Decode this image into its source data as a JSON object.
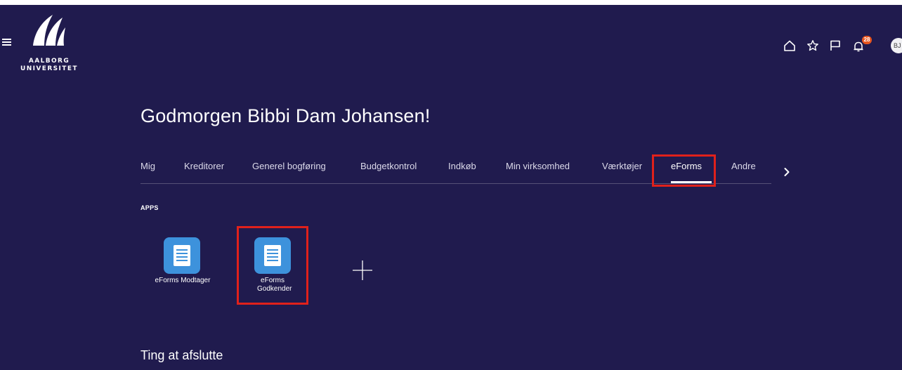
{
  "header": {
    "logo_line1": "AALBORG",
    "logo_line2": "UNIVERSITET",
    "icons": [
      "home-icon",
      "star-icon",
      "flag-icon",
      "bell-icon"
    ],
    "notification_count": "28",
    "avatar_initials": "BJ"
  },
  "greeting": "Godmorgen Bibbi Dam Johansen!",
  "tabs": [
    {
      "label": "Mig"
    },
    {
      "label": "Kreditorer"
    },
    {
      "label": "Generel bogføring"
    },
    {
      "label": "Budgetkontrol"
    },
    {
      "label": "Indkøb"
    },
    {
      "label": "Min virksomhed"
    },
    {
      "label": "Værktøjer"
    },
    {
      "label": "eForms",
      "active": true
    },
    {
      "label": "Andre"
    }
  ],
  "apps": {
    "section_label": "APPS",
    "items": [
      {
        "label": "eForms Modtager",
        "icon": "document-icon"
      },
      {
        "label": "eForms Godkender",
        "icon": "document-icon",
        "highlighted": true
      }
    ],
    "add_icon": "plus-icon"
  },
  "next_section_title": "Ting at afslutte",
  "colors": {
    "background": "#201b4e",
    "app_icon": "#3d92dc",
    "highlight": "#e0211b",
    "badge": "#e8561f"
  }
}
